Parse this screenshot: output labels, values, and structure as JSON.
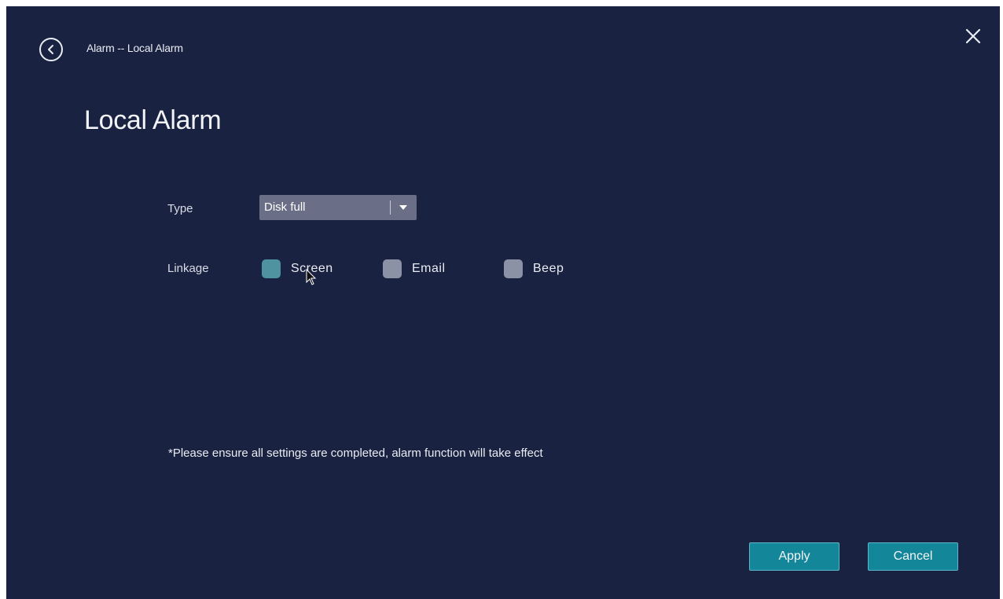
{
  "header": {
    "breadcrumb": "Alarm -- Local Alarm",
    "back_icon": "chevron-left-circle-icon",
    "close_icon": "close-icon"
  },
  "page": {
    "title": "Local Alarm"
  },
  "form": {
    "type_label": "Type",
    "type_value": "Disk full",
    "linkage_label": "Linkage",
    "linkage_options": [
      {
        "label": "Screen",
        "checked": true
      },
      {
        "label": "Email",
        "checked": false
      },
      {
        "label": "Beep",
        "checked": false
      }
    ]
  },
  "notice": "*Please ensure all settings are completed, alarm function will take effect",
  "actions": {
    "apply_label": "Apply",
    "cancel_label": "Cancel"
  },
  "colors": {
    "background": "#1a2241",
    "accent": "#148699",
    "checkbox": "#8c92a6",
    "checkbox_checked": "#4f93a0"
  }
}
